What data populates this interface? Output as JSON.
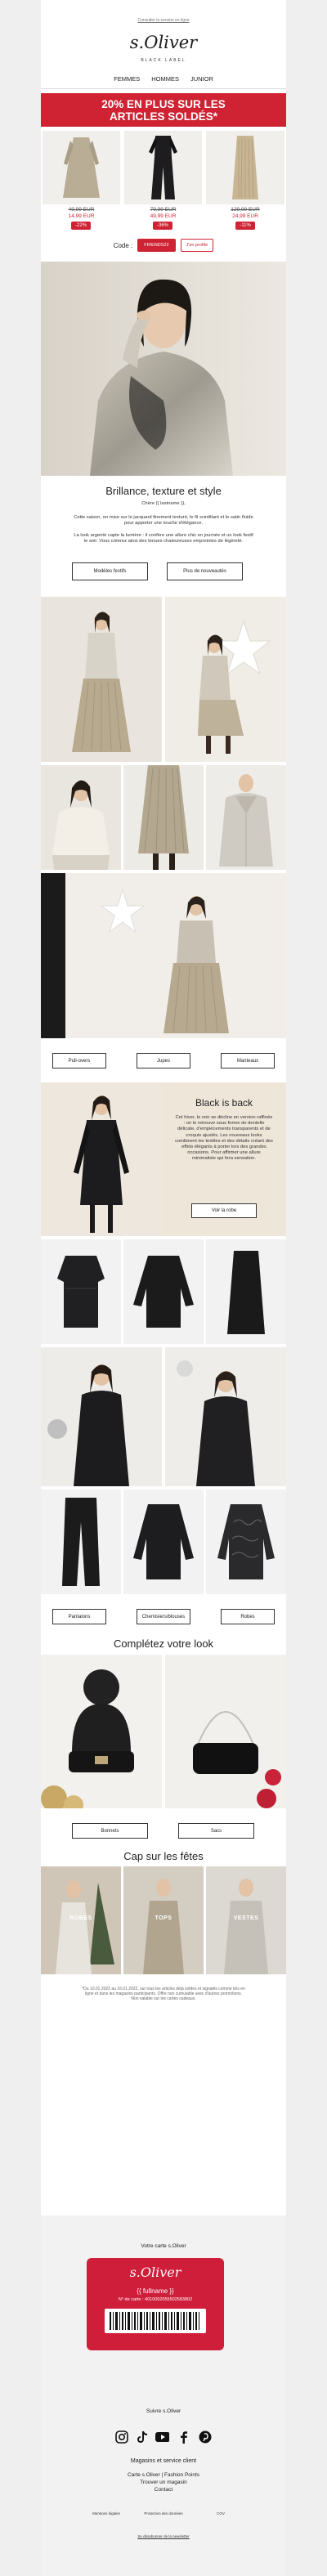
{
  "header": {
    "top_link": "Consulter la version en ligne",
    "logo": "s.Oliver",
    "logo_sub": "BLACK LABEL",
    "nav": [
      "FEMMES",
      "HOMMES",
      "JUNIOR"
    ]
  },
  "promo": {
    "line1": "20% EN PLUS SUR LES",
    "line2": "ARTICLES SOLDÉS*"
  },
  "products": [
    {
      "old": "49,99 EUR",
      "new": "14,99 EUR",
      "badge": "-22%"
    },
    {
      "old": "79,99 EUR",
      "new": "49,99 EUR",
      "badge": "-36%"
    },
    {
      "old": "129,99 EUR",
      "new": "24,99 EUR",
      "badge": "-11%"
    }
  ],
  "code": {
    "label": "Code :",
    "value": "FRIENDS22",
    "link": "J'en profite"
  },
  "brillance": {
    "title": "Brillance, texture et style",
    "greeting": "Chère {{ lastname }},",
    "text1": "Cette saison, on mise sur le jacquard finement texturé, le fil scintillant et le satin fluide pour apporter une touche d'élégance.",
    "text2": "La look argenté capte la lumière : il confère une allure chic en journée et un look festif le soir. Vous créerez ainsi des tenues chaleureuses empreintes de légèreté.",
    "btn1": "Modèles festifs",
    "btn2": "Plus de nouveautés"
  },
  "grid_buttons": {
    "b1": "Pull-overs",
    "b2": "Jupes",
    "b3": "Manteaux"
  },
  "black": {
    "title": "Black is back",
    "text": "Cet hiver, le noir se décline en version raffinée : on le retrouve sous forme de dentelle délicate, d'empiècements transparents et de croquis ajustés. Les nouveaux looks combinent les textiles et des détails créant des effets élégants à porter lors des grandes occasions. Pour affirmer une allure minimaliste qui fera sensation.",
    "btn": "Voir la robe"
  },
  "black_buttons": {
    "b1": "Pantalons",
    "b2": "Chemisiers/blouses",
    "b3": "Robes"
  },
  "complete": {
    "title": "Complétez votre look",
    "b1": "Bonnets",
    "b2": "Sacs"
  },
  "fetes": {
    "title": "Cap sur les fêtes",
    "labels": [
      "ROBES",
      "TOPS",
      "VESTES"
    ]
  },
  "legal": "*Du 10.01.2022 au 16.01.2022, sur tous les articles déjà soldés et signalés comme tels en ligne et dans les magasins participants. Offre non cumulable avec d'autres promotions. Non valable sur les cartes cadeaux.",
  "footer": {
    "card_title": "Votre carte s.Oliver",
    "card_logo": "s.Oliver",
    "card_name": "{{ fullname }}",
    "card_number": "N° de carte : 4010092055502583802",
    "follow": "Suivre s.Oliver",
    "service": "Magasins et service client",
    "links": [
      "Carte s.Oliver | Fashion Points",
      "Trouver un magasin",
      "Contact"
    ],
    "cols": [
      "Mentions légales",
      "Protection des données",
      "CGV"
    ],
    "unsubscribe": "Se désabonner de la newsletter"
  },
  "colors": {
    "accent": "#cf2233",
    "bg": "#efefef"
  }
}
